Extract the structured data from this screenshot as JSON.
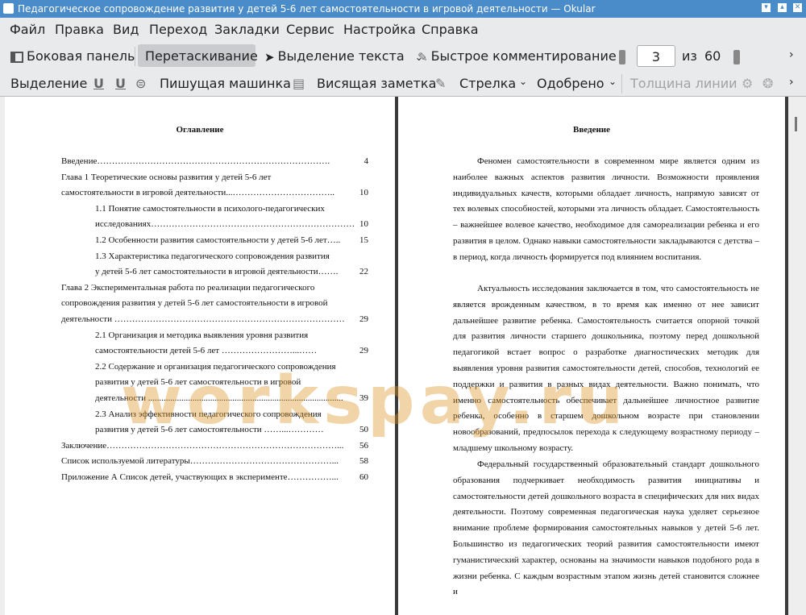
{
  "window": {
    "title": "Педагогическое сопровождение развития у детей 5-6 лет самостоятельности в игровой деятельности  — Okular"
  },
  "menu": [
    "Файл",
    "Правка",
    "Вид",
    "Переход",
    "Закладки",
    "Сервис",
    "Настройка",
    "Справка"
  ],
  "toolbar": {
    "sidebar_label": "Боковая панель",
    "drag_label": "Перетаскивание",
    "text_select_label": "Выделение текста",
    "quick_comment_label": "Быстрое комментирование",
    "page_current": "3",
    "page_of": "из",
    "page_total": "60"
  },
  "annot_toolbar": {
    "highlight": "Выделение",
    "typewriter": "Пишущая машинка",
    "note": "Висящая заметка",
    "arrow": "Стрелка",
    "stamp": "Одобрено",
    "line_width": "Толщина линии"
  },
  "left_page": {
    "title": "Оглавление",
    "toc": [
      {
        "text": "Введение…………………………………………………………………….",
        "page": "4"
      },
      {
        "text": "Глава 1 Теоретические основы развития у детей 5-6 лет",
        "page": ""
      },
      {
        "text": "самостоятельности в игровой деятельности...……………………………..",
        "page": "10"
      },
      {
        "text": "1.1 Понятие самостоятельности в психолого-педагогических",
        "page": ""
      },
      {
        "text": "исследованиях……………………………………………………………",
        "page": "10"
      },
      {
        "text": "1.2 Особенности развития самостоятельности у детей 5-6 лет…..",
        "page": "15"
      },
      {
        "text": "1.3 Характеристика педагогического сопровождения развития",
        "page": ""
      },
      {
        "text": "у детей 5-6 лет самостоятельности в игровой деятельности…….",
        "page": "22"
      },
      {
        "text": "Глава 2 Экспериментальная работа по реализации педагогического",
        "page": ""
      },
      {
        "text": "сопровождения развития у детей 5-6 лет самостоятельности в игровой",
        "page": ""
      },
      {
        "text": "деятельности ……………………………………………………………………",
        "page": "29"
      },
      {
        "text": "2.1 Организация и методика выявления уровня развития",
        "page": ""
      },
      {
        "text": "самостоятельности детей 5-6 лет ……………………...……",
        "page": "29"
      },
      {
        "text": "2.2 Содержание и организация педагогического сопровождения",
        "page": ""
      },
      {
        "text": "развития у детей 5-6 лет самостоятельности в игровой",
        "page": ""
      },
      {
        "text": "деятельности ........................................................................................",
        "page": "39"
      },
      {
        "text": "2.3 Анализ эффективности педагогического сопровождения",
        "page": ""
      },
      {
        "text": "развития у детей 5-6 лет самостоятельности ……...…………",
        "page": "50"
      },
      {
        "text": "Заключение……………………………………………………………………...",
        "page": "56"
      },
      {
        "text": "Список используемой литературы…………………………………………...",
        "page": "58"
      },
      {
        "text": "Приложение А Список детей, участвующих в эксперименте……………...",
        "page": "60"
      }
    ]
  },
  "right_page": {
    "title": "Введение",
    "paragraphs": [
      "Феномен самостоятельности в современном мире является одним из наиболее важных аспектов развития личности. Возможности проявления индивидуальных качеств, которыми обладает личность, напрямую зависят от тех волевых способностей, которыми эта личность обладает. Самостоятельность – важнейшее волевое качество, необходимое для самореализации ребенка и его развития в целом. Однако навыки самостоятельности закладываются с детства – в период, когда личность формируется под влиянием воспитания.",
      "Актуальность исследования заключается в том, что самостоятельность не является врожденным качеством, в то время как именно от нее зависит дальнейшее развитие ребенка. Самостоятельность считается опорной точкой для развития личности старшего дошкольника, поэтому перед дошкольной педагогикой встает вопрос о разработке диагностических методик для выявления уровня развития самостоятельности детей, способов, технологий ее поддержки и развития в разных видах деятельности. Важно понимать, что именно самостоятельность обеспечивает дальнейшее личностное развитие ребенка, особенно в старшем дошкольном возрасте при становлении новообразований, предпосылок перехода к следующему возрастному периоду – младшему школьному возрасту.",
      "Федеральный государственный образовательный стандарт дошкольного образования подчеркивает необходимость развития инициативы и самостоятельности детей дошкольного возраста в специфических для них видах деятельности. Поэтому современная педагогическая наука уделяет серьезное внимание проблеме формирования самостоятельных навыков у детей 5-6 лет. Большинство из педагогических теорий развития самостоятельности имеют гуманистический характер, основаны на значимости навыков подобного рода в жизни ребенка. С каждым возрастным этапом жизнь детей становится сложнее и"
    ]
  },
  "watermark": "workspay.ru",
  "colors": {
    "titlebar": "#4a8bc9",
    "watermark": "#dc9628"
  }
}
